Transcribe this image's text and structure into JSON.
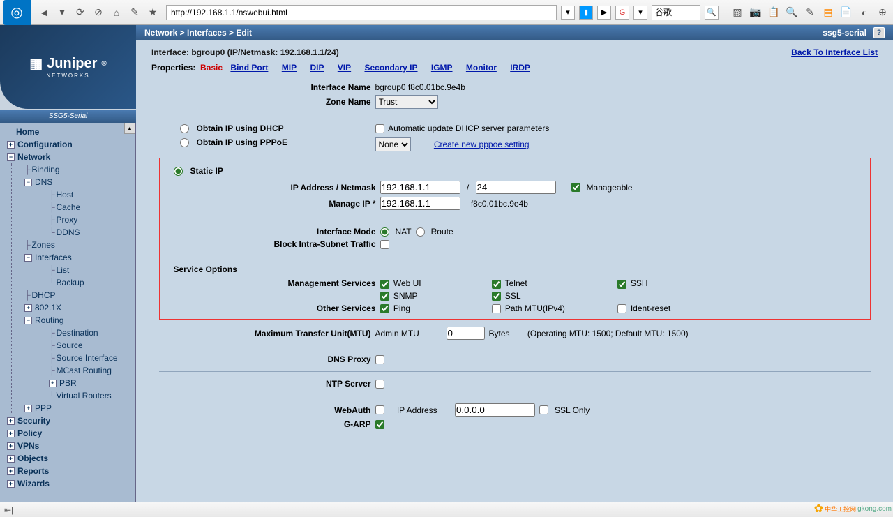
{
  "browser": {
    "url": "http://192.168.1.1/nswebui.html",
    "search_placeholder": "谷歌"
  },
  "crumb": "Network > Interfaces > Edit",
  "device": "ssg5-serial",
  "sidebar_device": "SSG5-Serial",
  "header": {
    "iface_title": "Interface: bgroup0 (IP/Netmask: 192.168.1.1/24)",
    "back_link": "Back To Interface List",
    "props_label": "Properties:",
    "active_tab": "Basic",
    "tabs": {
      "bind": "Bind Port",
      "mip": "MIP",
      "dip": "DIP",
      "vip": "VIP",
      "sec": "Secondary IP",
      "igmp": "IGMP",
      "mon": "Monitor",
      "irdp": "IRDP"
    }
  },
  "nav": {
    "home": "Home",
    "config": "Configuration",
    "network": "Network",
    "binding": "Binding",
    "dns": "DNS",
    "host": "Host",
    "cache": "Cache",
    "proxy": "Proxy",
    "ddns": "DDNS",
    "zones": "Zones",
    "interfaces": "Interfaces",
    "list": "List",
    "backup": "Backup",
    "dhcp": "DHCP",
    "dot1x": "802.1X",
    "routing": "Routing",
    "dest": "Destination",
    "source": "Source",
    "srcif": "Source Interface",
    "mcast": "MCast Routing",
    "pbr": "PBR",
    "vr": "Virtual Routers",
    "ppp": "PPP",
    "security": "Security",
    "policy": "Policy",
    "vpns": "VPNs",
    "objects": "Objects",
    "reports": "Reports",
    "wizards": "Wizards"
  },
  "form": {
    "iface_name_lbl": "Interface Name",
    "iface_name_val": "bgroup0 f8c0.01bc.9e4b",
    "zone_lbl": "Zone Name",
    "zone_val": "Trust",
    "dhcp": "Obtain IP using DHCP",
    "auto_dhcp": "Automatic update DHCP server parameters",
    "pppoe": "Obtain IP using PPPoE",
    "pppoe_sel": "None",
    "pppoe_link": "Create new pppoe setting",
    "static": "Static IP",
    "ipnm_lbl": "IP Address / Netmask",
    "ip": "192.168.1.1",
    "nm": "24",
    "manageable": "Manageable",
    "mgip_lbl": "Manage IP *",
    "mgip": "192.168.1.1",
    "mac": "f8c0.01bc.9e4b",
    "mode_lbl": "Interface Mode",
    "nat": "NAT",
    "route": "Route",
    "block_lbl": "Block Intra-Subnet Traffic",
    "svc_head": "Service Options",
    "mgmt_lbl": "Management Services",
    "web": "Web UI",
    "telnet": "Telnet",
    "ssh": "SSH",
    "snmp": "SNMP",
    "ssl": "SSL",
    "other_lbl": "Other Services",
    "ping": "Ping",
    "pmtu": "Path MTU(IPv4)",
    "ident": "Ident-reset",
    "mtu_lbl": "Maximum Transfer Unit(MTU)",
    "mtu_admin": "Admin MTU",
    "mtu_val": "0",
    "mtu_bytes": "Bytes",
    "mtu_note": "(Operating MTU: 1500; Default MTU: 1500)",
    "dnsproxy_lbl": "DNS Proxy",
    "ntp_lbl": "NTP Server",
    "webauth_lbl": "WebAuth",
    "webauth_ip_lbl": "IP Address",
    "webauth_ip": "0.0.0.0",
    "sslonly": "SSL Only",
    "garp_lbl": "G-ARP"
  },
  "watermark": "gkong.com",
  "watermark_cn": "中华工控网"
}
